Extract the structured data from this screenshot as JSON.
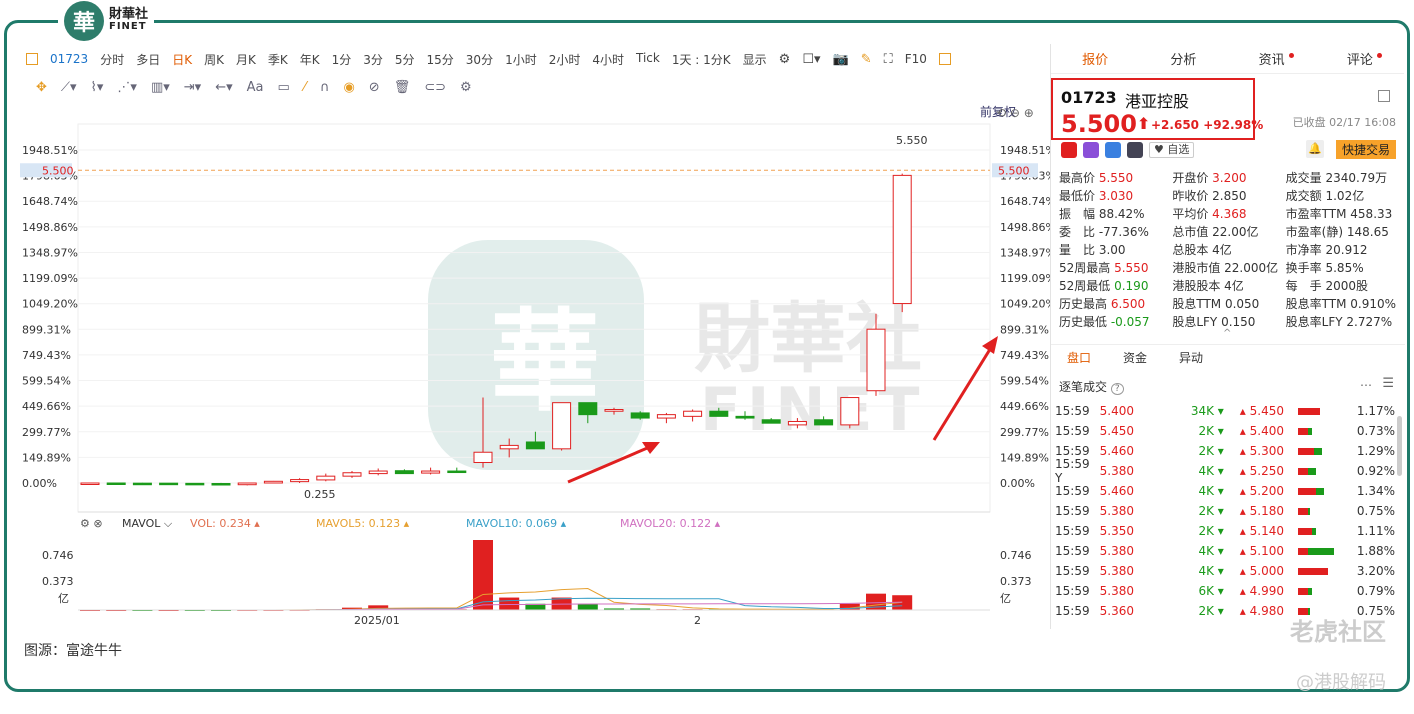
{
  "brand": {
    "seal": "華",
    "name_cn": "財華社",
    "name_en": "FINET"
  },
  "toolbar": {
    "code": "01723",
    "items": [
      "分时",
      "多日",
      "日K",
      "周K",
      "月K",
      "季K",
      "年K",
      "1分",
      "3分",
      "5分",
      "15分",
      "30分",
      "1小时",
      "2小时",
      "4小时",
      "Tick",
      "1天 : 1分K",
      "显示"
    ],
    "active": "日K",
    "right_label": "F10"
  },
  "chart_controls": {
    "adjust_label": "前复权"
  },
  "chart_data": [
    {
      "type": "candlestick",
      "y_tick_labels": [
        "1948.51%",
        "1798.63%",
        "1648.74%",
        "1498.86%",
        "1348.97%",
        "1199.09%",
        "1049.20%",
        "899.31%",
        "749.43%",
        "599.54%",
        "449.66%",
        "299.77%",
        "149.89%",
        "0.00%"
      ],
      "current_price_label": "5.500",
      "annotations": {
        "high": "5.550",
        "low": "0.255"
      },
      "x_tick_labels": [
        "2025/01",
        "2"
      ],
      "candles_ohlc_pct": [
        [
          0,
          2,
          -2,
          0
        ],
        [
          0,
          1,
          -2,
          -1
        ],
        [
          -1,
          1,
          -8,
          -10
        ],
        [
          -1,
          0,
          -4,
          -2
        ],
        [
          -2,
          0,
          -4,
          -3
        ],
        [
          -3,
          1,
          -12,
          -10
        ],
        [
          -10,
          3,
          -14,
          0
        ],
        [
          0,
          12,
          -2,
          10
        ],
        [
          8,
          28,
          0,
          20
        ],
        [
          18,
          55,
          10,
          40
        ],
        [
          40,
          70,
          30,
          60
        ],
        [
          55,
          85,
          45,
          70
        ],
        [
          72,
          80,
          60,
          55
        ],
        [
          58,
          90,
          50,
          70
        ],
        [
          70,
          90,
          60,
          65
        ],
        [
          120,
          500,
          90,
          180
        ],
        [
          200,
          260,
          150,
          220
        ],
        [
          240,
          300,
          200,
          200
        ],
        [
          200,
          470,
          190,
          470
        ],
        [
          470,
          470,
          350,
          400
        ],
        [
          420,
          440,
          400,
          430
        ],
        [
          410,
          420,
          370,
          380
        ],
        [
          380,
          410,
          350,
          400
        ],
        [
          390,
          430,
          360,
          420
        ],
        [
          420,
          440,
          400,
          390
        ],
        [
          390,
          420,
          370,
          380
        ],
        [
          370,
          380,
          350,
          350
        ],
        [
          340,
          380,
          320,
          360
        ],
        [
          370,
          390,
          340,
          340
        ],
        [
          340,
          500,
          320,
          500
        ],
        [
          540,
          990,
          510,
          900
        ],
        [
          1050,
          1810,
          1000,
          1800
        ]
      ]
    },
    {
      "type": "bar",
      "title": "MAVOL",
      "legend": {
        "vol": "VOL: 0.234",
        "ma5": "MAVOL5: 0.123",
        "ma10": "MAVOL10: 0.069",
        "ma20": "MAVOL20: 0.122"
      },
      "y_tick_labels": [
        "0.746",
        "0.373",
        "亿"
      ],
      "volumes": [
        0,
        0,
        0,
        0,
        0,
        0,
        0.002,
        0.002,
        0.003,
        0.01,
        0.03,
        0.06,
        0.02,
        0.01,
        0.01,
        0.9,
        0.16,
        0.08,
        0.16,
        0.08,
        0.02,
        0.02,
        0.01,
        0.01,
        0.01,
        0.01,
        0.01,
        0.01,
        0.01,
        0.08,
        0.21,
        0.19
      ],
      "volume_up": [
        true,
        true,
        false,
        true,
        false,
        false,
        true,
        true,
        true,
        true,
        true,
        true,
        false,
        true,
        true,
        true,
        true,
        false,
        true,
        false,
        false,
        false,
        true,
        true,
        false,
        false,
        false,
        true,
        false,
        true,
        true,
        true
      ]
    }
  ],
  "source_text": "图源：富途牛牛",
  "watermark": {
    "main": "老虎社区",
    "handle": "@港股解码",
    "center_cn": "財華社",
    "center_en": "FINET"
  },
  "panel": {
    "tabs": [
      "报价",
      "分析",
      "资讯",
      "评论"
    ],
    "code": "01723",
    "name": "港亚控股",
    "price": "5.500",
    "arrow": "⬆",
    "change": "+2.650",
    "change_pct": "+92.98%",
    "closed": "已收盘 02/17 16:08",
    "favorite": "自选",
    "quick_trade": "快捷交易",
    "stats": [
      [
        [
          "最高价",
          "5.550",
          "red"
        ],
        [
          "开盘价",
          "3.200",
          "red"
        ],
        [
          "成交量",
          "2340.79万",
          ""
        ]
      ],
      [
        [
          "最低价",
          "3.030",
          "red"
        ],
        [
          "昨收价",
          "2.850",
          ""
        ],
        [
          "成交额",
          "1.02亿",
          ""
        ]
      ],
      [
        [
          "振　幅",
          "88.42%",
          ""
        ],
        [
          "平均价",
          "4.368",
          "red"
        ],
        [
          "市盈率TTM",
          "458.33",
          ""
        ]
      ],
      [
        [
          "委　比",
          "-77.36%",
          ""
        ],
        [
          "总市值",
          "22.00亿",
          ""
        ],
        [
          "市盈率(静)",
          "148.65",
          ""
        ]
      ],
      [
        [
          "量　比",
          "3.00",
          ""
        ],
        [
          "总股本",
          "4亿",
          ""
        ],
        [
          "市净率",
          "20.912",
          ""
        ]
      ],
      [
        [
          "52周最高",
          "5.550",
          "red"
        ],
        [
          "港股市值",
          "22.000亿",
          ""
        ],
        [
          "换手率",
          "5.85%",
          ""
        ]
      ],
      [
        [
          "52周最低",
          "0.190",
          "green"
        ],
        [
          "港股股本",
          "4亿",
          ""
        ],
        [
          "每　手",
          "2000股",
          ""
        ]
      ],
      [
        [
          "历史最高",
          "6.500",
          "red"
        ],
        [
          "股息TTM",
          "0.050",
          ""
        ],
        [
          "股息率TTM",
          "0.910%",
          ""
        ]
      ],
      [
        [
          "历史最低",
          "-0.057",
          "green"
        ],
        [
          "股息LFY",
          "0.150",
          ""
        ],
        [
          "股息率LFY",
          "2.727%",
          ""
        ]
      ]
    ],
    "sub_tabs": [
      "盘口",
      "资金",
      "异动"
    ],
    "ticks_title": "逐笔成交",
    "ticks": [
      [
        "15:59",
        "5.400",
        "34K",
        "5.450",
        "1.17%"
      ],
      [
        "15:59",
        "5.450",
        "2K",
        "5.400",
        "0.73%"
      ],
      [
        "15:59",
        "5.460",
        "2K",
        "5.300",
        "1.29%"
      ],
      [
        "15:59 Y",
        "5.380",
        "4K",
        "5.250",
        "0.92%"
      ],
      [
        "15:59",
        "5.460",
        "4K",
        "5.200",
        "1.34%"
      ],
      [
        "15:59",
        "5.380",
        "2K",
        "5.180",
        "0.75%"
      ],
      [
        "15:59",
        "5.350",
        "2K",
        "5.140",
        "1.11%"
      ],
      [
        "15:59",
        "5.380",
        "4K",
        "5.100",
        "1.88%"
      ],
      [
        "15:59",
        "5.380",
        "4K",
        "5.000",
        "3.20%"
      ],
      [
        "15:59",
        "5.380",
        "6K",
        "4.990",
        "0.79%"
      ],
      [
        "15:59",
        "5.360",
        "2K",
        "4.980",
        "0.75%"
      ]
    ]
  },
  "colors": {
    "up": "#e02020",
    "down": "#1a9a1a",
    "accent": "#e05a00",
    "frame": "#1f7a6a"
  }
}
